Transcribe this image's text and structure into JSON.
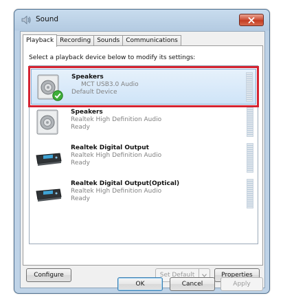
{
  "window": {
    "title": "Sound",
    "close_icon": "close-x-icon"
  },
  "tabs": [
    {
      "label": "Playback",
      "active": true
    },
    {
      "label": "Recording",
      "active": false
    },
    {
      "label": "Sounds",
      "active": false
    },
    {
      "label": "Communications",
      "active": false
    }
  ],
  "playback": {
    "instruction": "Select a playback device below to modify its settings:",
    "devices": [
      {
        "name": "Speakers",
        "description": "MCT USB3.0 Audio",
        "status": "Default Device",
        "icon": "speaker-icon",
        "selected": true,
        "default_badge": "green-check-icon"
      },
      {
        "name": "Speakers",
        "description": "Realtek High Definition Audio",
        "status": "Ready",
        "icon": "speaker-icon",
        "selected": false
      },
      {
        "name": "Realtek Digital Output",
        "description": "Realtek High Definition Audio",
        "status": "Ready",
        "icon": "digital-output-icon",
        "selected": false
      },
      {
        "name": "Realtek Digital Output(Optical)",
        "description": "Realtek High Definition Audio",
        "status": "Ready",
        "icon": "digital-output-icon",
        "selected": false
      }
    ]
  },
  "buttons": {
    "configure": "Configure",
    "set_default": "Set Default",
    "properties": "Properties",
    "ok": "OK",
    "cancel": "Cancel",
    "apply": "Apply"
  },
  "colors": {
    "highlight_border": "#d42331",
    "selection_fill": "#cfe4f8",
    "close_button": "#c43c22"
  }
}
